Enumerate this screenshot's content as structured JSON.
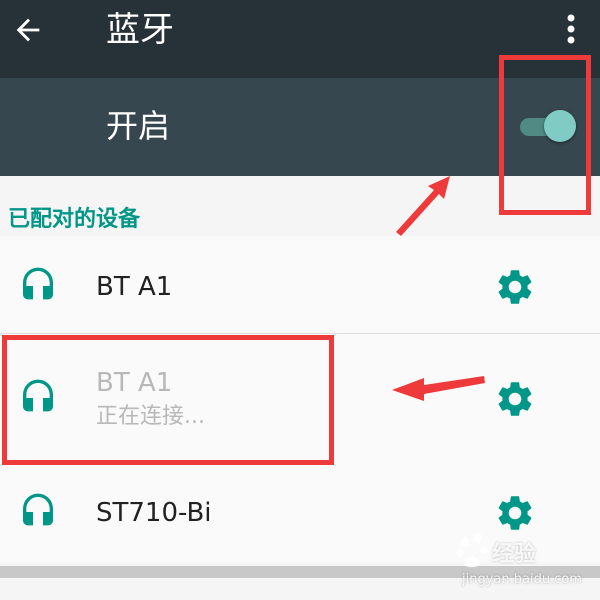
{
  "app_bar": {
    "title": "蓝牙",
    "back_icon": "arrow-back-icon",
    "menu_icon": "more-vert-icon"
  },
  "bluetooth_switch": {
    "label": "开启",
    "state": "on"
  },
  "paired_devices": {
    "header": "已配对的设备",
    "items": [
      {
        "name": "BT A1",
        "status": "",
        "icon": "headset-icon",
        "settings_icon": "gear-icon"
      },
      {
        "name": "BT A1",
        "status": "正在连接...",
        "icon": "headset-icon",
        "settings_icon": "gear-icon"
      },
      {
        "name": "ST710-Bi",
        "status": "",
        "icon": "headset-icon",
        "settings_icon": "gear-icon"
      }
    ]
  },
  "colors": {
    "app_bar": "#263238",
    "switch_bar": "#37474f",
    "accent": "#009688",
    "toggle_thumb": "#80cbc4",
    "annotation": "#ee3a3a"
  },
  "watermark": {
    "brand": "经验",
    "url": "jingyan.baidu.com"
  }
}
